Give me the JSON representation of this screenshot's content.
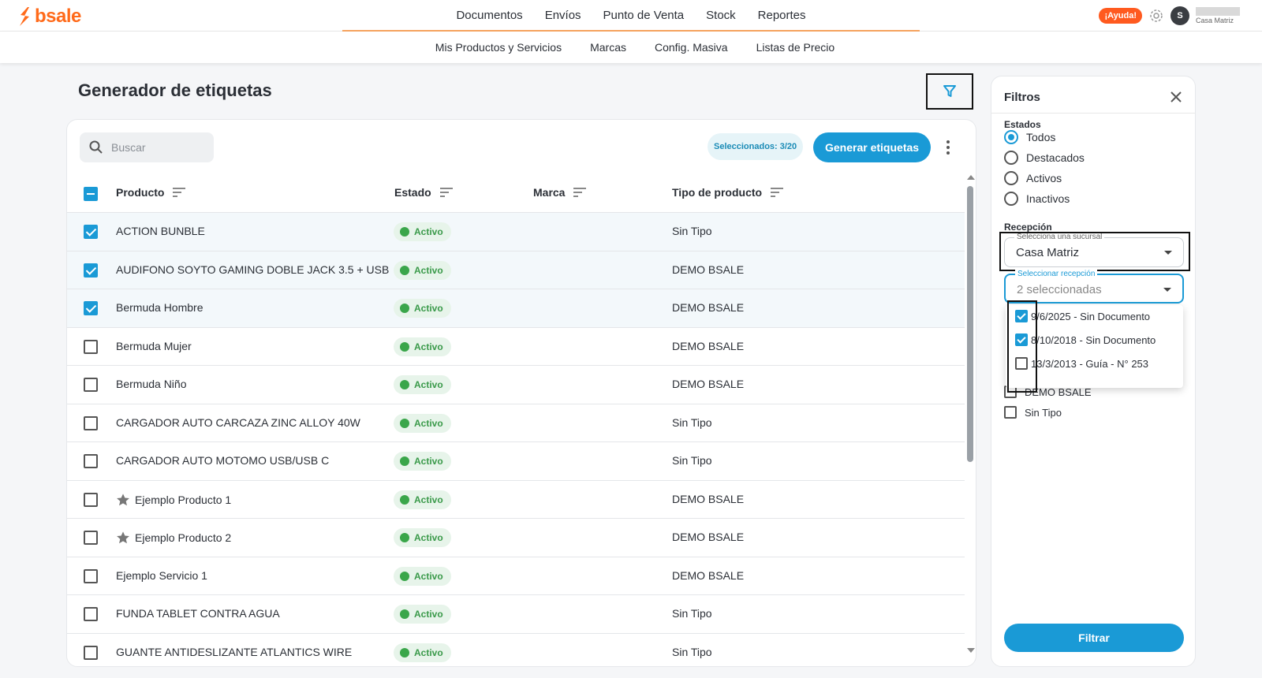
{
  "app": {
    "logo": "bsale"
  },
  "topnav": {
    "items": [
      "Documentos",
      "Envíos",
      "Punto de Venta",
      "Stock",
      "Reportes"
    ],
    "help": "¡Ayuda!",
    "avatar_initial": "S",
    "user_branch": "Casa Matriz"
  },
  "subnav": {
    "items": [
      "Mis Productos y Servicios",
      "Marcas",
      "Config. Masiva",
      "Listas de Precio"
    ]
  },
  "page": {
    "title": "Generador de etiquetas"
  },
  "toolbar": {
    "search_placeholder": "Buscar",
    "selected_badge": "Seleccionados: 3/20",
    "generate_label": "Generar etiquetas"
  },
  "table": {
    "headers": {
      "product": "Producto",
      "status": "Estado",
      "brand": "Marca",
      "type": "Tipo de producto"
    },
    "rows": [
      {
        "checked": true,
        "featured": false,
        "name": "ACTION BUNBLE",
        "status": "Activo",
        "brand": "",
        "type": "Sin Tipo"
      },
      {
        "checked": true,
        "featured": false,
        "name": "AUDIFONO SOYTO GAMING DOBLE JACK 3.5 + USB",
        "status": "Activo",
        "brand": "",
        "type": "DEMO BSALE"
      },
      {
        "checked": true,
        "featured": false,
        "name": "Bermuda Hombre",
        "status": "Activo",
        "brand": "",
        "type": "DEMO BSALE"
      },
      {
        "checked": false,
        "featured": false,
        "name": "Bermuda Mujer",
        "status": "Activo",
        "brand": "",
        "type": "DEMO BSALE"
      },
      {
        "checked": false,
        "featured": false,
        "name": "Bermuda Niño",
        "status": "Activo",
        "brand": "",
        "type": "DEMO BSALE"
      },
      {
        "checked": false,
        "featured": false,
        "name": "CARGADOR AUTO CARCAZA ZINC ALLOY 40W",
        "status": "Activo",
        "brand": "",
        "type": "Sin Tipo"
      },
      {
        "checked": false,
        "featured": false,
        "name": "CARGADOR AUTO MOTOMO USB/USB C",
        "status": "Activo",
        "brand": "",
        "type": "Sin Tipo"
      },
      {
        "checked": false,
        "featured": true,
        "name": "Ejemplo Producto 1",
        "status": "Activo",
        "brand": "",
        "type": "DEMO BSALE"
      },
      {
        "checked": false,
        "featured": true,
        "name": "Ejemplo Producto 2",
        "status": "Activo",
        "brand": "",
        "type": "DEMO BSALE"
      },
      {
        "checked": false,
        "featured": false,
        "name": "Ejemplo Servicio 1",
        "status": "Activo",
        "brand": "",
        "type": "DEMO BSALE"
      },
      {
        "checked": false,
        "featured": false,
        "name": "FUNDA TABLET CONTRA AGUA",
        "status": "Activo",
        "brand": "",
        "type": "Sin Tipo"
      },
      {
        "checked": false,
        "featured": false,
        "name": "GUANTE ANTIDESLIZANTE ATLANTICS WIRE",
        "status": "Activo",
        "brand": "",
        "type": "Sin Tipo"
      }
    ]
  },
  "filters": {
    "title": "Filtros",
    "states_label": "Estados",
    "states": [
      {
        "label": "Todos",
        "selected": true
      },
      {
        "label": "Destacados",
        "selected": false
      },
      {
        "label": "Activos",
        "selected": false
      },
      {
        "label": "Inactivos",
        "selected": false
      }
    ],
    "reception_label": "Recepción",
    "branch_field": {
      "label": "Selecciona una sucursal",
      "value": "Casa Matriz"
    },
    "reception_field": {
      "label": "Seleccionar recepción",
      "value": "2 seleccionadas"
    },
    "reception_options": [
      {
        "label": "9/6/2025 - Sin Documento",
        "checked": true
      },
      {
        "label": "8/10/2018 - Sin Documento",
        "checked": true
      },
      {
        "label": "13/3/2013 - Guía - N° 253",
        "checked": false
      }
    ],
    "type_options": [
      {
        "label": "DEMO BSALE",
        "checked": false
      },
      {
        "label": "Sin Tipo",
        "checked": false
      }
    ],
    "apply_label": "Filtrar"
  },
  "colors": {
    "brand": "#ff6a1a",
    "accent": "#1a9ad6",
    "success": "#3aa64a"
  }
}
